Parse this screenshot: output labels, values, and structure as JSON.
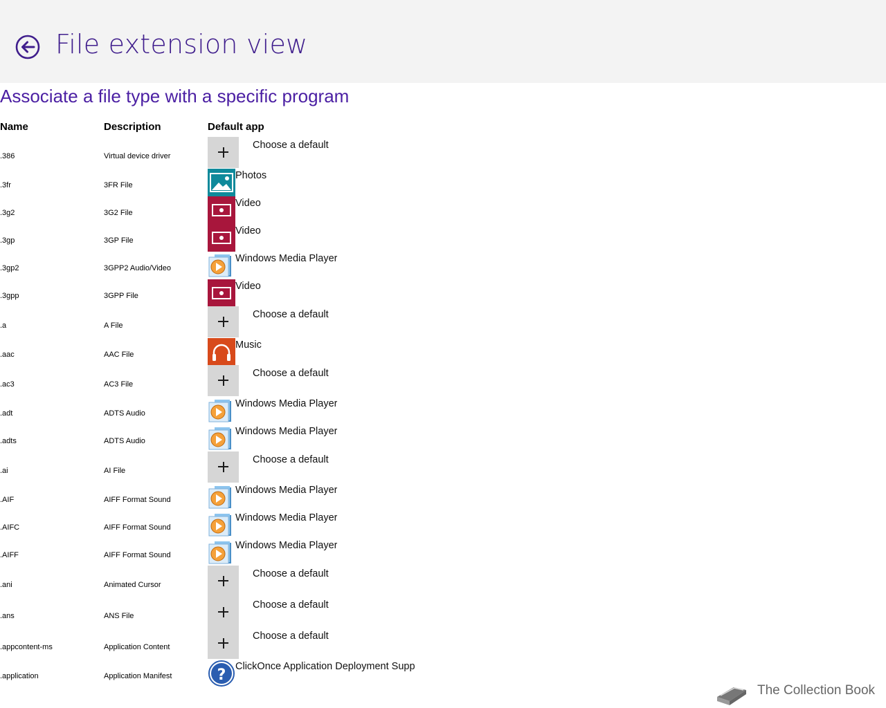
{
  "header": {
    "title": "File extension view"
  },
  "subtitle": "Associate a file type with a specific program",
  "columns": {
    "name": "Name",
    "description": "Description",
    "default_app": "Default app"
  },
  "rows": [
    {
      "name": ".386",
      "description": "Virtual device driver",
      "app": "Choose a default",
      "icon": "plus-icon"
    },
    {
      "name": ".3fr",
      "description": "3FR File",
      "app": "Photos",
      "icon": "photos-icon"
    },
    {
      "name": ".3g2",
      "description": "3G2 File",
      "app": "Video",
      "icon": "video-icon"
    },
    {
      "name": ".3gp",
      "description": "3GP File",
      "app": "Video",
      "icon": "video-icon"
    },
    {
      "name": ".3gp2",
      "description": "3GPP2 Audio/Video",
      "app": "Windows Media Player",
      "icon": "wmp-icon"
    },
    {
      "name": ".3gpp",
      "description": "3GPP File",
      "app": "Video",
      "icon": "video-icon"
    },
    {
      "name": ".a",
      "description": "A File",
      "app": "Choose a default",
      "icon": "plus-icon"
    },
    {
      "name": ".aac",
      "description": "AAC File",
      "app": "Music",
      "icon": "music-icon"
    },
    {
      "name": ".ac3",
      "description": "AC3 File",
      "app": "Choose a default",
      "icon": "plus-icon"
    },
    {
      "name": ".adt",
      "description": "ADTS Audio",
      "app": "Windows Media Player",
      "icon": "wmp-icon"
    },
    {
      "name": ".adts",
      "description": "ADTS Audio",
      "app": "Windows Media Player",
      "icon": "wmp-icon"
    },
    {
      "name": ".ai",
      "description": "AI File",
      "app": "Choose a default",
      "icon": "plus-icon"
    },
    {
      "name": ".AIF",
      "description": "AIFF Format Sound",
      "app": "Windows Media Player",
      "icon": "wmp-icon"
    },
    {
      "name": ".AIFC",
      "description": "AIFF Format Sound",
      "app": "Windows Media Player",
      "icon": "wmp-icon"
    },
    {
      "name": ".AIFF",
      "description": "AIFF Format Sound",
      "app": "Windows Media Player",
      "icon": "wmp-icon"
    },
    {
      "name": ".ani",
      "description": "Animated Cursor",
      "app": "Choose a default",
      "icon": "plus-icon"
    },
    {
      "name": ".ans",
      "description": "ANS File",
      "app": "Choose a default",
      "icon": "plus-icon"
    },
    {
      "name": ".appcontent-ms",
      "description": "Application Content",
      "app": "Choose a default",
      "icon": "plus-icon"
    },
    {
      "name": ".application",
      "description": "Application Manifest",
      "app": "ClickOnce Application Deployment Suppc",
      "icon": "help-icon"
    }
  ],
  "branding": {
    "text": "The Collection Book",
    "icon": "book-icon"
  }
}
